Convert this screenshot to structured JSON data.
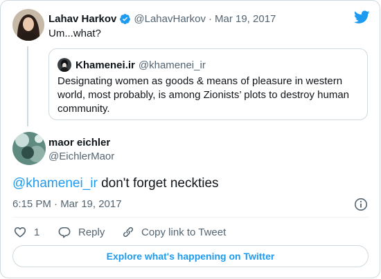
{
  "parent_tweet": {
    "author_name": "Lahav Harkov",
    "handle": "@LahavHarkov",
    "separator": "·",
    "date": "Mar 19, 2017",
    "text": "Um...what?",
    "verified": true
  },
  "quoted_tweet": {
    "author_name": "Khamenei.ir",
    "handle": "@khamenei_ir",
    "text": "Designating women as goods & means of pleasure in western world, most probably, is among Zionists’ plots to destroy human community."
  },
  "main_tweet": {
    "author_name": "maor eichler",
    "handle": "@EichlerMaor",
    "mention": "@khamenei_ir",
    "text_rest": " don't forget neckties",
    "timestamp": "6:15 PM · Mar 19, 2017"
  },
  "actions": {
    "like_count": "1",
    "reply_label": "Reply",
    "copy_link_label": "Copy link to Tweet"
  },
  "explore": {
    "label": "Explore what's happening on Twitter"
  },
  "icons": {
    "brand": "twitter-bird-icon",
    "verified": "verified-badge-icon",
    "info": "info-icon",
    "like": "heart-icon",
    "reply": "reply-bubble-icon",
    "link": "link-icon"
  },
  "colors": {
    "accent": "#1d9bf0",
    "text": "#0f1419",
    "muted": "#536471",
    "border": "#cfd9de"
  }
}
